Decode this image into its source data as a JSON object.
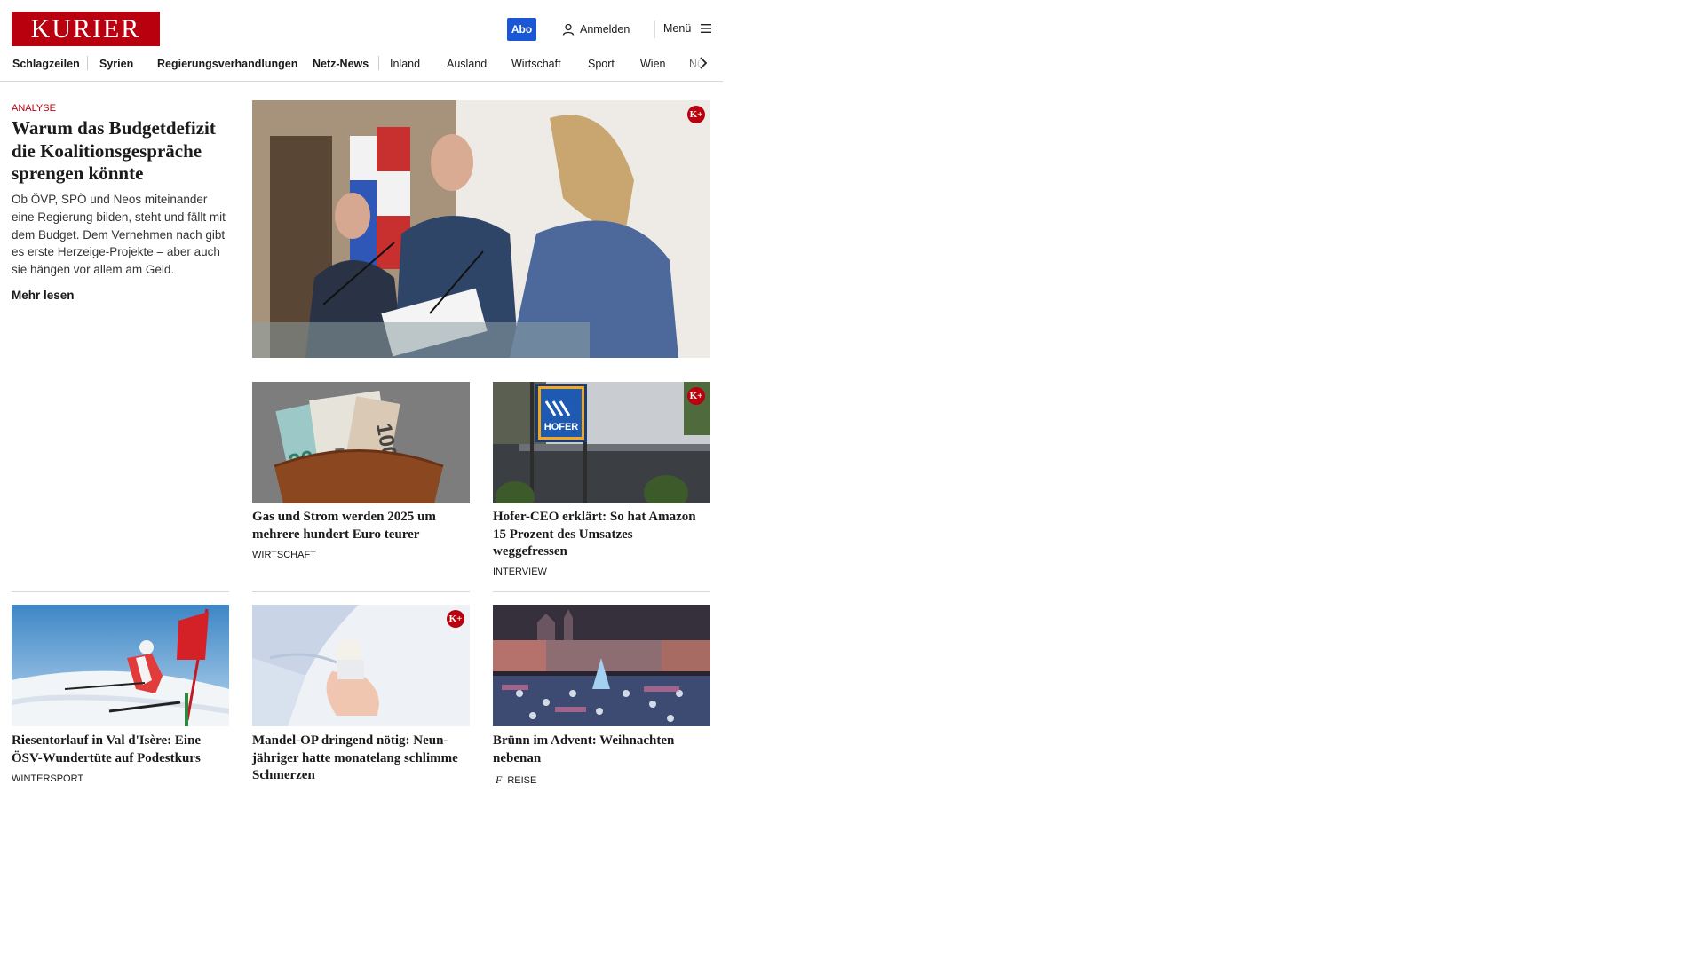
{
  "header": {
    "logo": "KURIER",
    "abo_label": "Abo",
    "login_label": "Anmelden",
    "menu_label": "Menü"
  },
  "nav": {
    "items": [
      {
        "label": "Schlagzeilen",
        "bold": true
      },
      {
        "label": "Syrien",
        "bold": true
      },
      {
        "label": "Regierungsverhandlungen",
        "bold": true
      },
      {
        "label": "Netz-News",
        "bold": true
      },
      {
        "label": "Inland",
        "bold": false
      },
      {
        "label": "Ausland",
        "bold": false
      },
      {
        "label": "Wirtschaft",
        "bold": false
      },
      {
        "label": "Sport",
        "bold": false
      },
      {
        "label": "Wien",
        "bold": false
      },
      {
        "label": "NÖ",
        "bold": false
      }
    ]
  },
  "lead": {
    "kicker": "ANALYSE",
    "title": "Warum das Budgetdefizit die Koalitionsgespräche sprengen könnte",
    "teaser": "Ob ÖVP, SPÖ und Neos miteinander eine Regierung bilden, steht und fällt mit dem Budget. Dem Vernehmen nach gibt es erste Herzeige-Projekte – aber auch sie hängen vor allem am Geld.",
    "more_label": "Mehr lesen",
    "badge": "K+"
  },
  "cards": [
    {
      "title": "Gas und Strom werden 2025 um mehrere hundert Euro teurer",
      "category": "WIRTSCHAFT",
      "premium": false
    },
    {
      "title": "Hofer-CEO erklärt: So hat Amazon 15 Prozent des Umsatzes weggefressen",
      "category": "INTERVIEW",
      "premium": true,
      "badge": "K+",
      "sign_text": "HOFER"
    },
    {
      "title": "Riesentorlauf in Val d'Isère: Eine ÖSV-Wundertüte auf Podestkurs",
      "category": "WINTERSPORT",
      "premium": false
    },
    {
      "title": "Mandel-OP dringend nötig: Neun-jähriger hatte monatelang schlimme Schmerzen",
      "category": "",
      "premium": true,
      "badge": "K+"
    },
    {
      "title": "Brünn im Advent: Weihnachten nebenan",
      "category": "REISE",
      "premium": false,
      "category_icon": "freizeit-icon"
    }
  ],
  "wallet_img_text": {
    "note_a": "100",
    "note_b": "20",
    "note_c": "5"
  }
}
